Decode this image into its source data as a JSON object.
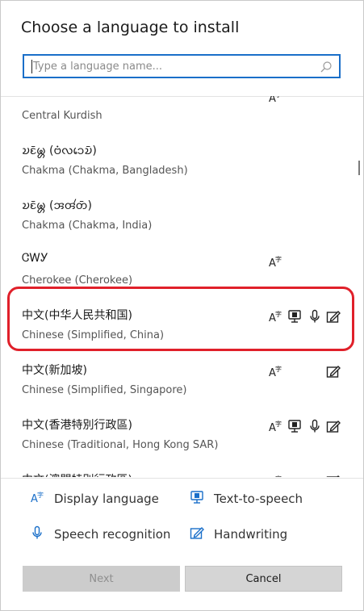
{
  "dialog": {
    "title": "Choose a language to install",
    "search": {
      "placeholder": "Type a language name...",
      "value": ""
    }
  },
  "languages": [
    {
      "native": "",
      "description": "Central Kurdish",
      "features": [
        "display"
      ]
    },
    {
      "native": "𑄌𑄋𑄴𑄟𑄳𑄦 (𑄝𑄁𑄣𑄘𑄬𑄌𑄴)",
      "description": "Chakma (Chakma, Bangladesh)",
      "features": []
    },
    {
      "native": "𑄌𑄋𑄴𑄟𑄳𑄦 (𑄞𑄢𑄧𑄖𑄴)",
      "description": "Chakma (Chakma, India)",
      "features": []
    },
    {
      "native": "ᏣᎳᎩ",
      "description": "Cherokee (Cherokee)",
      "features": [
        "display"
      ]
    },
    {
      "native": "中文(中华人民共和国)",
      "description": "Chinese (Simplified, China)",
      "features": [
        "display",
        "tts",
        "speech",
        "handwriting"
      ],
      "highlighted": true
    },
    {
      "native": "中文(新加坡)",
      "description": "Chinese (Simplified, Singapore)",
      "features": [
        "display",
        "handwriting"
      ]
    },
    {
      "native": "中文(香港特別行政區)",
      "description": "Chinese (Traditional, Hong Kong SAR)",
      "features": [
        "display",
        "tts",
        "speech",
        "handwriting"
      ]
    },
    {
      "native": "中文(澳門特別行政區)",
      "description": "",
      "features": [
        "display",
        "handwriting"
      ]
    }
  ],
  "legend": {
    "display": "Display language",
    "tts": "Text-to-speech",
    "speech": "Speech recognition",
    "handwriting": "Handwriting"
  },
  "buttons": {
    "next": "Next",
    "cancel": "Cancel"
  },
  "colors": {
    "accent": "#1a6fc9",
    "highlight": "#e0202a",
    "icon": "#1a6fc9"
  }
}
